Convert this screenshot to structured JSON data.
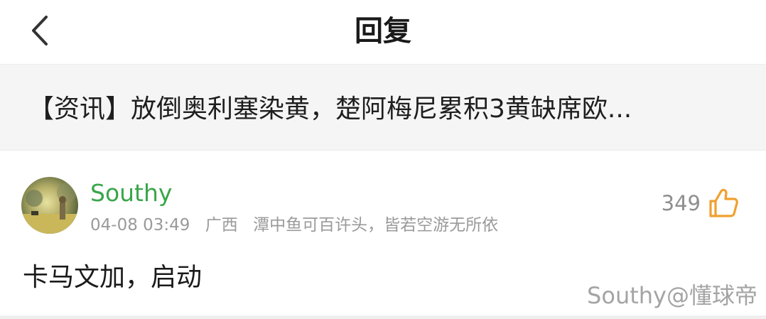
{
  "header": {
    "title": "回复",
    "back_icon": "chevron-left-icon"
  },
  "article": {
    "title": "【资讯】放倒奥利塞染黄，楚阿梅尼累积3黄缺席欧..."
  },
  "comment": {
    "username": "Southy",
    "datetime": "04-08 03:49",
    "location": "广西",
    "signature": "潭中鱼可百许头，皆若空游无所依",
    "like_count": "349",
    "like_icon": "thumbs-up-icon",
    "text": "卡马文加，启动",
    "watermark": "Southy@懂球帝"
  },
  "colors": {
    "username": "#3aa64a",
    "like_icon": "#f0a030",
    "banner_bg": "#f5f5f5"
  }
}
